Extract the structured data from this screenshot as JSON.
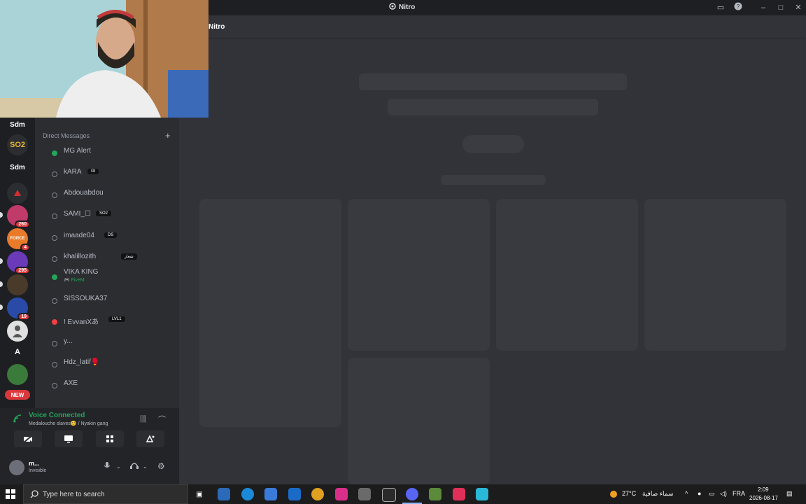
{
  "window": {
    "title": "Nitro"
  },
  "main": {
    "header_title": "Nitro"
  },
  "servers": [
    {
      "name": "Sdm",
      "label": "Sdm",
      "badge": ""
    },
    {
      "name": "SO2",
      "label": "SO2",
      "badge": ""
    },
    {
      "name": "Sdm-2",
      "label": "Sdm",
      "badge": ""
    },
    {
      "name": "server-red",
      "label": "",
      "badge": ""
    },
    {
      "name": "server-260",
      "label": "",
      "badge": "260"
    },
    {
      "name": "server-force",
      "label": "FORCE",
      "badge": "4"
    },
    {
      "name": "server-295",
      "label": "",
      "badge": "295"
    },
    {
      "name": "server-dark",
      "label": "",
      "badge": ""
    },
    {
      "name": "server-19",
      "label": "",
      "badge": "19"
    },
    {
      "name": "server-person",
      "label": "",
      "badge": ""
    },
    {
      "name": "server-a",
      "label": "A",
      "badge": ""
    },
    {
      "name": "server-green",
      "label": "",
      "badge": ""
    }
  ],
  "new_badge": "NEW",
  "dm": {
    "header": "Direct Messages",
    "add": "+",
    "items": [
      {
        "name": "MG Alert",
        "tag": "",
        "status": "online",
        "sub": ""
      },
      {
        "name": "kARA",
        "tag": "GI",
        "status": "offline",
        "sub": ""
      },
      {
        "name": "Abdouabdou",
        "tag": "",
        "status": "offline",
        "sub": ""
      },
      {
        "name": "SAMI_☐",
        "tag": "SO2",
        "status": "offline",
        "sub": ""
      },
      {
        "name": "imaade04",
        "tag": "DS",
        "status": "offline",
        "sub": ""
      },
      {
        "name": "khalillozith",
        "tag": "شعار",
        "status": "offline",
        "sub": ""
      },
      {
        "name": "VIKA KING",
        "tag": "",
        "status": "online",
        "sub": "🎮 FiveM"
      },
      {
        "name": "SISSOUKA37",
        "tag": "",
        "status": "offline",
        "sub": ""
      },
      {
        "name": "! EvvanXあ",
        "tag": "LVL1",
        "status": "dnd",
        "sub": ""
      },
      {
        "name": "y...",
        "tag": "",
        "status": "offline",
        "sub": ""
      },
      {
        "name": "Hdz_latif🥊",
        "tag": "",
        "status": "offline",
        "sub": ""
      },
      {
        "name": "AXE",
        "tag": "",
        "status": "offline",
        "sub": ""
      }
    ]
  },
  "voice": {
    "status": "Voice Connected",
    "channel": "Medalouche slaves😊 / Nyakin gang"
  },
  "user": {
    "name": "m...",
    "status": "Invisible"
  },
  "taskbar": {
    "search_placeholder": "Type here to search",
    "weather": "27°C",
    "weather_text": "سماء صافية",
    "lang": "FRA",
    "time": "2:09",
    "date": "2026-08-17"
  },
  "colors": {
    "online": "#23a55a",
    "dnd": "#f23f43",
    "accent": "#5865f2"
  }
}
